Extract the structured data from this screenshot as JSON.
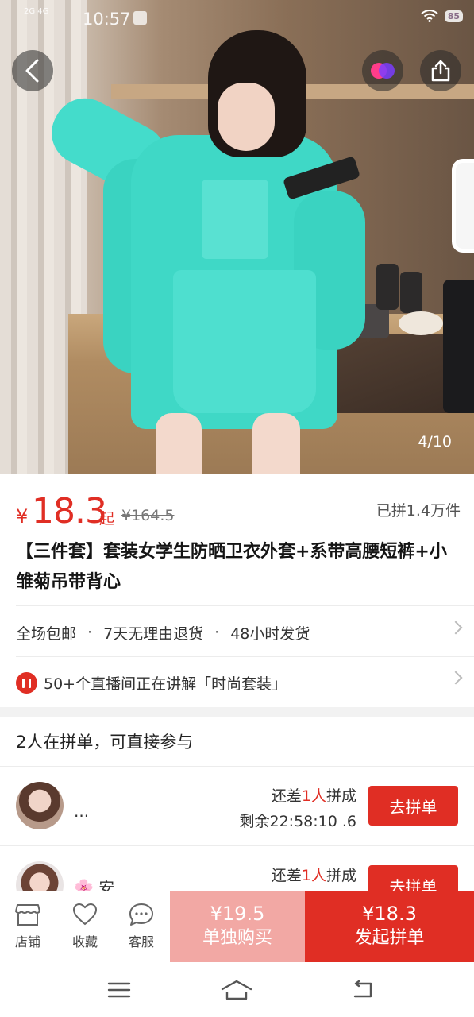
{
  "status_bar": {
    "network": "2G 4G",
    "time": "10:57",
    "battery": "85"
  },
  "gallery": {
    "counter": "4/10"
  },
  "product": {
    "currency": "¥",
    "price": "18.3",
    "price_suffix": "起",
    "original_price": "¥164.5",
    "sold": "已拼1.4万件",
    "title": "【三件套】套装女学生防晒卫衣外套+系带高腰短裤+小雏菊吊带背心",
    "promises": [
      "全场包邮",
      "7天无理由退货",
      "48小时发货"
    ],
    "promise_separator": "·",
    "live_text": "50+个直播间正在讲解「时尚套装」"
  },
  "group_buy": {
    "heading": "2人在拼单，可直接参与",
    "rows": [
      {
        "name": "...",
        "need_prefix": "还差",
        "need_count": "1人",
        "need_suffix": "拼成",
        "remain": "剩余22:58:10 .6",
        "button": "去拼单"
      },
      {
        "name": "🌸 安",
        "need_prefix": "还差",
        "need_count": "1人",
        "need_suffix": "拼成",
        "remain": "",
        "button": "去拼单"
      }
    ]
  },
  "action_bar": {
    "store": "店铺",
    "favorite": "收藏",
    "service": "客服",
    "solo_price": "¥19.5",
    "solo_label": "单独购买",
    "group_price": "¥18.3",
    "group_label": "发起拼单"
  },
  "colors": {
    "accent": "#e02e24",
    "solo_button": "#f2a8a4"
  },
  "icons": [
    "back-icon",
    "brand-logo-icon",
    "share-icon",
    "store-icon",
    "heart-icon",
    "chat-icon",
    "live-icon",
    "chevron-right-icon",
    "menu-icon",
    "home-icon",
    "return-icon"
  ]
}
